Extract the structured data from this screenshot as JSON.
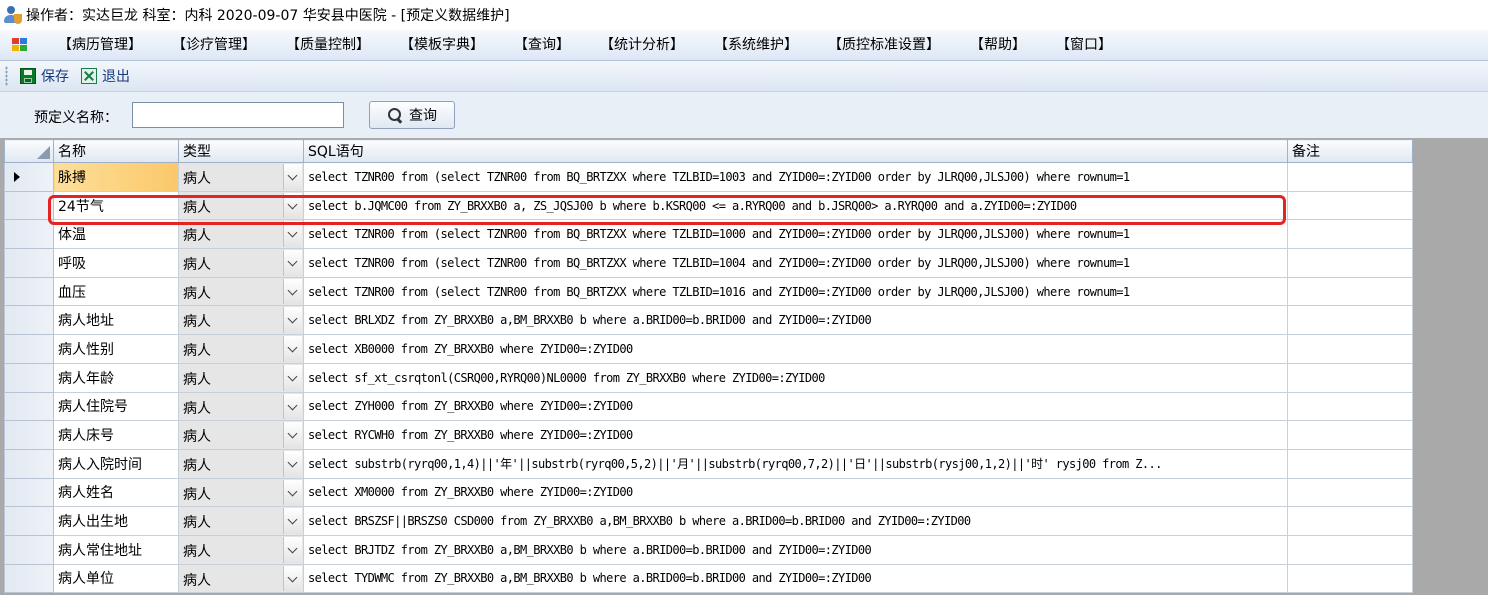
{
  "window": {
    "title": "操作者：实达巨龙 科室：内科 2020-09-07 华安县中医院 - [预定义数据维护]"
  },
  "menu": [
    "【病历管理】",
    "【诊疗管理】",
    "【质量控制】",
    "【模板字典】",
    "【查询】",
    "【统计分析】",
    "【系统维护】",
    "【质控标准设置】",
    "【帮助】",
    "【窗口】"
  ],
  "toolbar": {
    "save_label": "保存",
    "exit_label": "退出"
  },
  "search": {
    "label": "预定义名称：",
    "value": "",
    "button_label": "查询"
  },
  "grid": {
    "columns": [
      "名称",
      "类型",
      "SQL语句",
      "备注"
    ],
    "rows": [
      {
        "name": "脉搏",
        "type": "病人",
        "sql": "select TZNR00 from (select TZNR00 from BQ_BRTZXX where TZLBID=1003 and ZYID00=:ZYID00 order by JLRQ00,JLSJ00) where rownum=1",
        "note": ""
      },
      {
        "name": "24节气",
        "type": "病人",
        "sql": "select b.JQMC00 from ZY_BRXXB0 a, ZS_JQSJ00 b where b.KSRQ00 <= a.RYRQ00 and b.JSRQ00> a.RYRQ00 and  a.ZYID00=:ZYID00",
        "note": ""
      },
      {
        "name": "体温",
        "type": "病人",
        "sql": "select TZNR00 from (select TZNR00 from BQ_BRTZXX where TZLBID=1000 and ZYID00=:ZYID00 order by JLRQ00,JLSJ00) where rownum=1",
        "note": ""
      },
      {
        "name": "呼吸",
        "type": "病人",
        "sql": "select TZNR00 from (select TZNR00 from BQ_BRTZXX where TZLBID=1004 and ZYID00=:ZYID00 order by JLRQ00,JLSJ00) where rownum=1",
        "note": ""
      },
      {
        "name": "血压",
        "type": "病人",
        "sql": "select TZNR00 from (select TZNR00 from BQ_BRTZXX where TZLBID=1016 and ZYID00=:ZYID00 order by JLRQ00,JLSJ00) where rownum=1",
        "note": ""
      },
      {
        "name": "病人地址",
        "type": "病人",
        "sql": "select BRLXDZ from ZY_BRXXB0 a,BM_BRXXB0 b where a.BRID00=b.BRID00 and ZYID00=:ZYID00",
        "note": ""
      },
      {
        "name": "病人性别",
        "type": "病人",
        "sql": "select XB0000 from ZY_BRXXB0 where ZYID00=:ZYID00",
        "note": ""
      },
      {
        "name": "病人年龄",
        "type": "病人",
        "sql": "select sf_xt_csrqtonl(CSRQ00,RYRQ00)NL0000 from ZY_BRXXB0 where ZYID00=:ZYID00",
        "note": ""
      },
      {
        "name": "病人住院号",
        "type": "病人",
        "sql": "select ZYH000 from ZY_BRXXB0 where ZYID00=:ZYID00",
        "note": ""
      },
      {
        "name": "病人床号",
        "type": "病人",
        "sql": "select RYCWH0 from ZY_BRXXB0 where ZYID00=:ZYID00",
        "note": ""
      },
      {
        "name": "病人入院时间",
        "type": "病人",
        "sql": "select substrb(ryrq00,1,4)||'年'||substrb(ryrq00,5,2)||'月'||substrb(ryrq00,7,2)||'日'||substrb(rysj00,1,2)||'时' rysj00 from Z...",
        "note": ""
      },
      {
        "name": "病人姓名",
        "type": "病人",
        "sql": "select XM0000 from ZY_BRXXB0 where ZYID00=:ZYID00",
        "note": ""
      },
      {
        "name": "病人出生地",
        "type": "病人",
        "sql": "select BRSZSF||BRSZS0 CSD000 from ZY_BRXXB0 a,BM_BRXXB0 b where a.BRID00=b.BRID00 and ZYID00=:ZYID00",
        "note": ""
      },
      {
        "name": "病人常住地址",
        "type": "病人",
        "sql": "select BRJTDZ from ZY_BRXXB0 a,BM_BRXXB0 b where a.BRID00=b.BRID00 and ZYID00=:ZYID00",
        "note": ""
      },
      {
        "name": "病人单位",
        "type": "病人",
        "sql": "select TYDWMC from ZY_BRXXB0 a,BM_BRXXB0 b where a.BRID00=b.BRID00 and ZYID00=:ZYID00",
        "note": ""
      }
    ],
    "current_row": 0,
    "highlighted_row": 1
  },
  "colors": {
    "highlight_box": "#e32424",
    "current_row_fill": "#fbc86a",
    "menubar_bg": "#dde7f4"
  }
}
